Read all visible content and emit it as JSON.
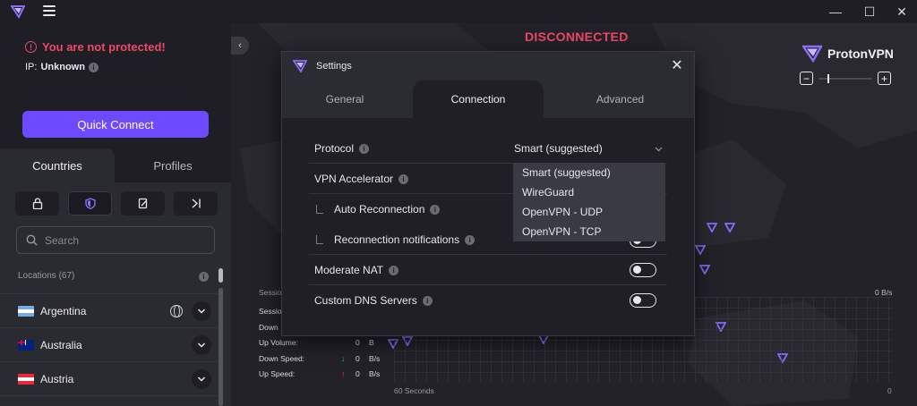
{
  "app": {
    "brand_name": "ProtonVPN",
    "accent_color": "#6d4aff",
    "alert_color": "#f0476a"
  },
  "window_controls": {
    "minimize": "—",
    "maximize": "☐",
    "close": "✕"
  },
  "sidebar": {
    "alert_text": "You are not protected!",
    "ip_label": "IP:",
    "ip_value": "Unknown",
    "quick_connect_label": "Quick Connect",
    "tabs": {
      "countries": "Countries",
      "profiles": "Profiles"
    },
    "filter_icons": [
      "lock-icon",
      "shield-icon",
      "edit-icon",
      "arrow-to-edge-icon"
    ],
    "search_placeholder": "Search",
    "locations_label": "Locations (67)",
    "countries": [
      {
        "name": "Argentina",
        "flag": "argentina-flag"
      },
      {
        "name": "Australia",
        "flag": "australia-flag"
      },
      {
        "name": "Austria",
        "flag": "austria-flag"
      }
    ]
  },
  "map": {
    "status": "DISCONNECTED",
    "session": {
      "header": "Sessio",
      "session_row": "Sessio",
      "down_row": "Down",
      "up_volume_label": "Up Volume:",
      "up_volume_value": "0",
      "up_volume_unit": "B",
      "down_speed_label": "Down Speed:",
      "down_speed_value": "0",
      "down_speed_unit": "B/s",
      "up_speed_label": "Up Speed:",
      "up_speed_value": "0",
      "up_speed_unit": "B/s",
      "axis_right_top": "0 B/s",
      "axis_left_bottom": "60 Seconds",
      "axis_right_bottom": "0"
    },
    "zoom": {
      "minus": "−",
      "plus": "+"
    }
  },
  "settings_dialog": {
    "title": "Settings",
    "close": "✕",
    "tabs": {
      "general": "General",
      "connection": "Connection",
      "advanced": "Advanced"
    },
    "rows": {
      "protocol": "Protocol",
      "vpn_accelerator": "VPN Accelerator",
      "auto_reconnection": "Auto Reconnection",
      "reconnection_notifications": "Reconnection notifications",
      "moderate_nat": "Moderate NAT",
      "custom_dns": "Custom DNS Servers"
    },
    "protocol_selected": "Smart (suggested)",
    "protocol_options": [
      "Smart (suggested)",
      "WireGuard",
      "OpenVPN - UDP",
      "OpenVPN - TCP"
    ]
  }
}
